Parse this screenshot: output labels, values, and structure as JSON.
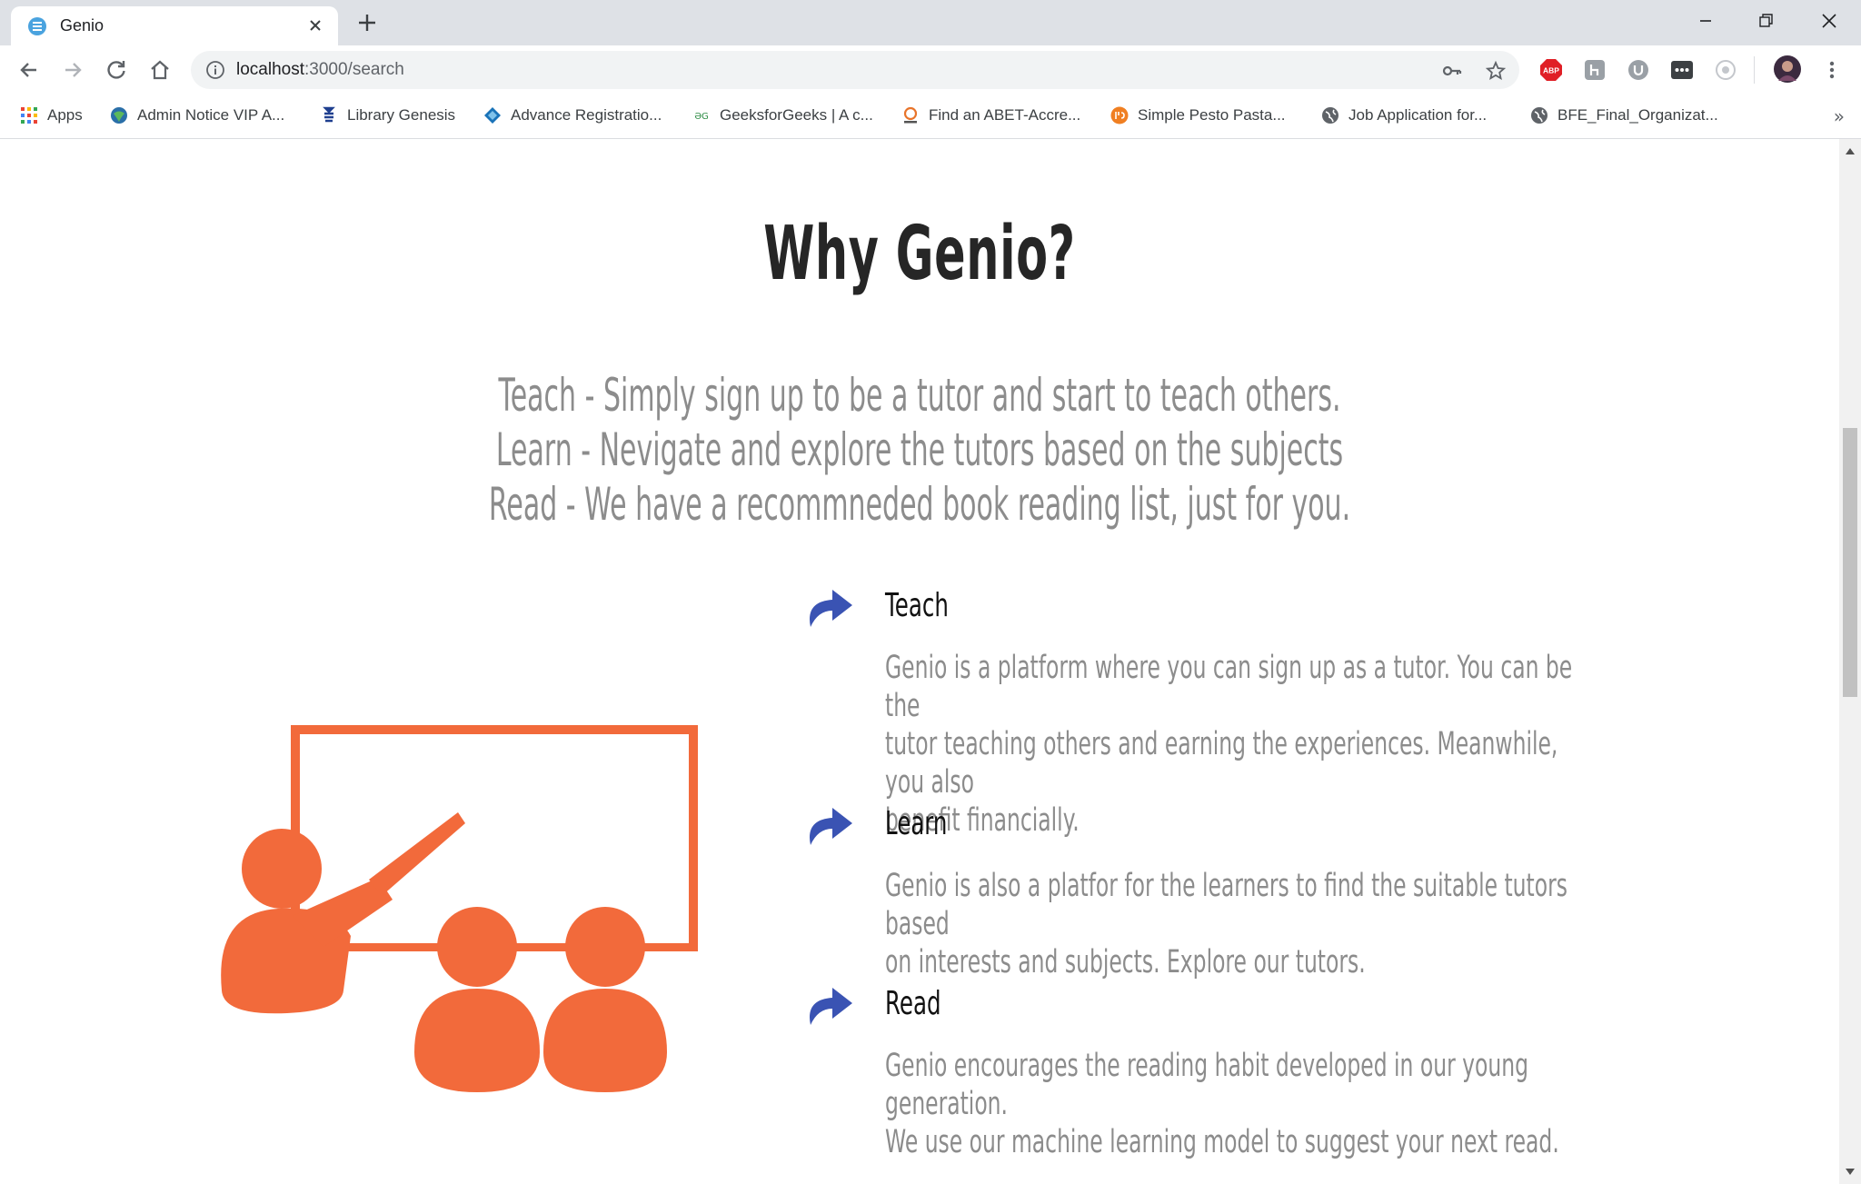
{
  "browser": {
    "tab": {
      "title": "Genio"
    },
    "url": {
      "host": "localhost",
      "path": ":3000/search"
    },
    "bookmarks": [
      {
        "label": "Apps",
        "icon": "apps-grid-icon"
      },
      {
        "label": "Admin Notice VIP A...",
        "icon": "globe-icon"
      },
      {
        "label": "Library Genesis",
        "icon": "library-icon"
      },
      {
        "label": "Advance Registratio...",
        "icon": "registration-icon"
      },
      {
        "label": "GeeksforGeeks | A c...",
        "icon": "geeksforgeeks-icon"
      },
      {
        "label": "Find an ABET-Accre...",
        "icon": "abet-icon"
      },
      {
        "label": "Simple Pesto Pasta...",
        "icon": "recipe-icon"
      },
      {
        "label": "Job Application for...",
        "icon": "globe-icon"
      },
      {
        "label": "BFE_Final_Organizat...",
        "icon": "globe-icon"
      }
    ],
    "bookmarks_more": "»",
    "extensions": {
      "abp_label": "ABP"
    }
  },
  "page": {
    "title": "Why Genio?",
    "intro_lines": [
      "Teach - Simply sign up to be a tutor and start to teach others.",
      "Learn - Nevigate and explore the tutors based on the subjects",
      "Read - We have a recommneded book reading list, just for you."
    ],
    "features": [
      {
        "title": "Teach",
        "lines": [
          "Genio is a platform where you can sign up as a tutor. You can be the",
          "tutor teaching others and earning the experiences. Meanwhile, you also",
          "benefit financially."
        ]
      },
      {
        "title": "Learn",
        "lines": [
          "Genio is also a platfor for the learners to find the suitable tutors based",
          "on interests and subjects. Explore our tutors."
        ]
      },
      {
        "title": "Read",
        "lines": [
          "Genio encourages the reading habit developed in our young generation.",
          "We use our machine learning model to suggest your next read."
        ]
      }
    ]
  },
  "colors": {
    "accent_orange": "#f26a3b",
    "arrow_blue": "#3a53b3",
    "text_gray": "#8c8c8c",
    "title_dark": "#262626"
  }
}
